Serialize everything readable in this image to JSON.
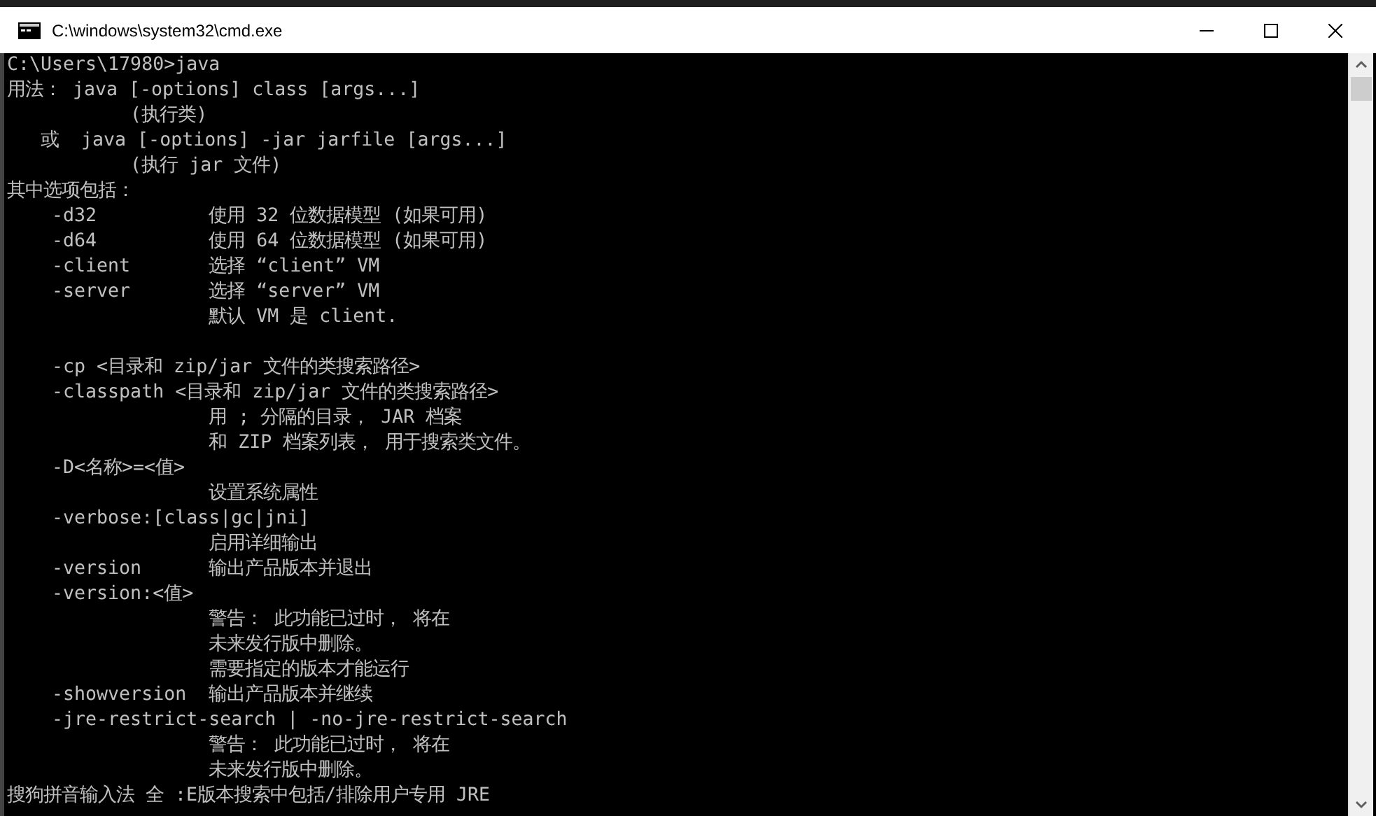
{
  "window": {
    "title": "C:\\windows\\system32\\cmd.exe"
  },
  "console": {
    "lines": [
      {
        "kind": "text",
        "text": "C:\\Users\\17980>java"
      },
      {
        "kind": "text",
        "text": "用法： java [-options] class [args...]"
      },
      {
        "kind": "text",
        "text": "           (执行类)"
      },
      {
        "kind": "text",
        "text": "   或  java [-options] -jar jarfile [args...]"
      },
      {
        "kind": "text",
        "text": "           (执行 jar 文件)"
      },
      {
        "kind": "text",
        "text": "其中选项包括："
      },
      {
        "kind": "text",
        "text": "    -d32          使用 32 位数据模型 (如果可用)"
      },
      {
        "kind": "text",
        "text": "    -d64          使用 64 位数据模型 (如果可用)"
      },
      {
        "kind": "text",
        "text": "    -client       选择 “client” VM"
      },
      {
        "kind": "text",
        "text": "    -server       选择 “server” VM"
      },
      {
        "kind": "text",
        "text": "                  默认 VM 是 client."
      },
      {
        "kind": "blank"
      },
      {
        "kind": "text",
        "text": "    -cp <目录和 zip/jar 文件的类搜索路径>"
      },
      {
        "kind": "text",
        "text": "    -classpath <目录和 zip/jar 文件的类搜索路径>"
      },
      {
        "kind": "text",
        "text": "                  用 ; 分隔的目录， JAR 档案"
      },
      {
        "kind": "text",
        "text": "                  和 ZIP 档案列表， 用于搜索类文件。"
      },
      {
        "kind": "text",
        "text": "    -D<名称>=<值>"
      },
      {
        "kind": "text",
        "text": "                  设置系统属性"
      },
      {
        "kind": "text",
        "text": "    -verbose:[class|gc|jni]"
      },
      {
        "kind": "text",
        "text": "                  启用详细输出"
      },
      {
        "kind": "text",
        "text": "    -version      输出产品版本并退出"
      },
      {
        "kind": "text",
        "text": "    -version:<值>"
      },
      {
        "kind": "text",
        "text": "                  警告： 此功能已过时， 将在"
      },
      {
        "kind": "text",
        "text": "                  未来发行版中删除。"
      },
      {
        "kind": "text",
        "text": "                  需要指定的版本才能运行"
      },
      {
        "kind": "text",
        "text": "    -showversion  输出产品版本并继续"
      },
      {
        "kind": "text",
        "text": "    -jre-restrict-search | -no-jre-restrict-search"
      },
      {
        "kind": "text",
        "text": "                  警告： 此功能已过时， 将在"
      },
      {
        "kind": "text",
        "text": "                  未来发行版中删除。"
      },
      {
        "kind": "ime",
        "text": "搜狗拼音输入法 全 :E版本搜索中包括/排除用户专用 JRE"
      }
    ]
  }
}
